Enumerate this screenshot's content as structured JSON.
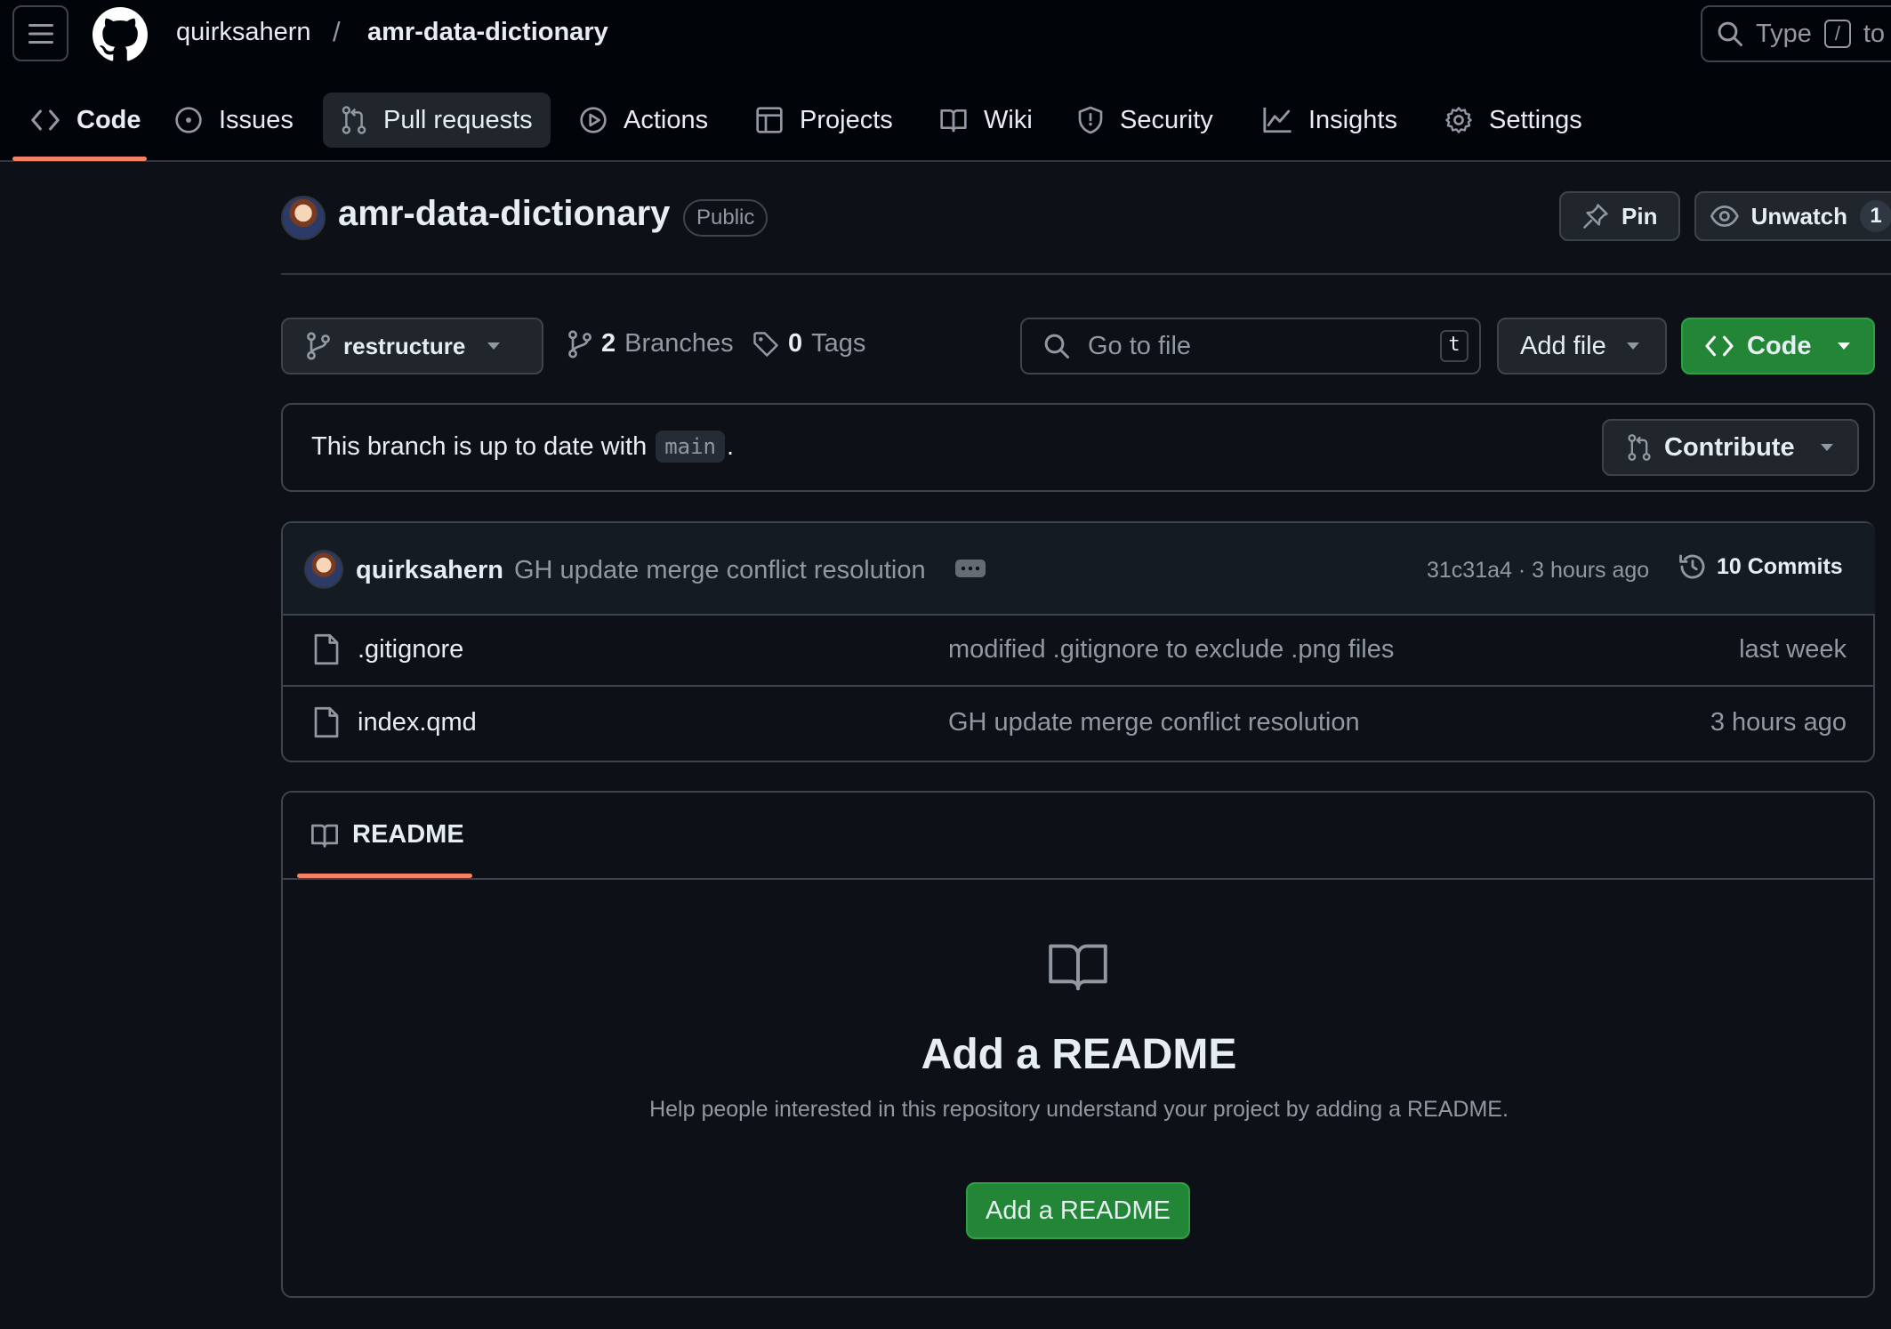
{
  "header": {
    "owner": "quirksahern",
    "separator": "/",
    "repo": "amr-data-dictionary",
    "search_prefix": "Type",
    "search_key": "/",
    "search_suffix": "to s"
  },
  "nav": {
    "code": "Code",
    "issues": "Issues",
    "pull_requests": "Pull requests",
    "actions": "Actions",
    "projects": "Projects",
    "wiki": "Wiki",
    "security": "Security",
    "insights": "Insights",
    "settings": "Settings"
  },
  "repo_header": {
    "name": "amr-data-dictionary",
    "visibility": "Public",
    "pin_label": "Pin",
    "unwatch_label": "Unwatch",
    "watch_count": "1"
  },
  "toolbar": {
    "branch": "restructure",
    "branches_count": "2",
    "branches_label": "Branches",
    "tags_count": "0",
    "tags_label": "Tags",
    "goto_placeholder": "Go to file",
    "goto_key": "t",
    "add_file": "Add file",
    "code": "Code"
  },
  "branch_status": {
    "text": "This branch is up to date with",
    "base_branch": "main",
    "period": ".",
    "contribute": "Contribute"
  },
  "latest_commit": {
    "author": "quirksahern",
    "message": "GH update merge conflict resolution",
    "sha": "31c31a4",
    "dot": "·",
    "time": "3 hours ago",
    "commits_label": "10 Commits"
  },
  "files": [
    {
      "name": ".gitignore",
      "message": "modified .gitignore to exclude .png files",
      "time": "last week"
    },
    {
      "name": "index.qmd",
      "message": "GH update merge conflict resolution",
      "time": "3 hours ago"
    }
  ],
  "readme": {
    "tab": "README",
    "heading": "Add a README",
    "description": "Help people interested in this repository understand your project by adding a README.",
    "button": "Add a README"
  },
  "colors": {
    "background": "#0d1117",
    "header_bg": "#010409",
    "border": "#3d444d",
    "accent_underline": "#f78166",
    "green_button": "#238636",
    "muted_text": "#9198a1"
  }
}
